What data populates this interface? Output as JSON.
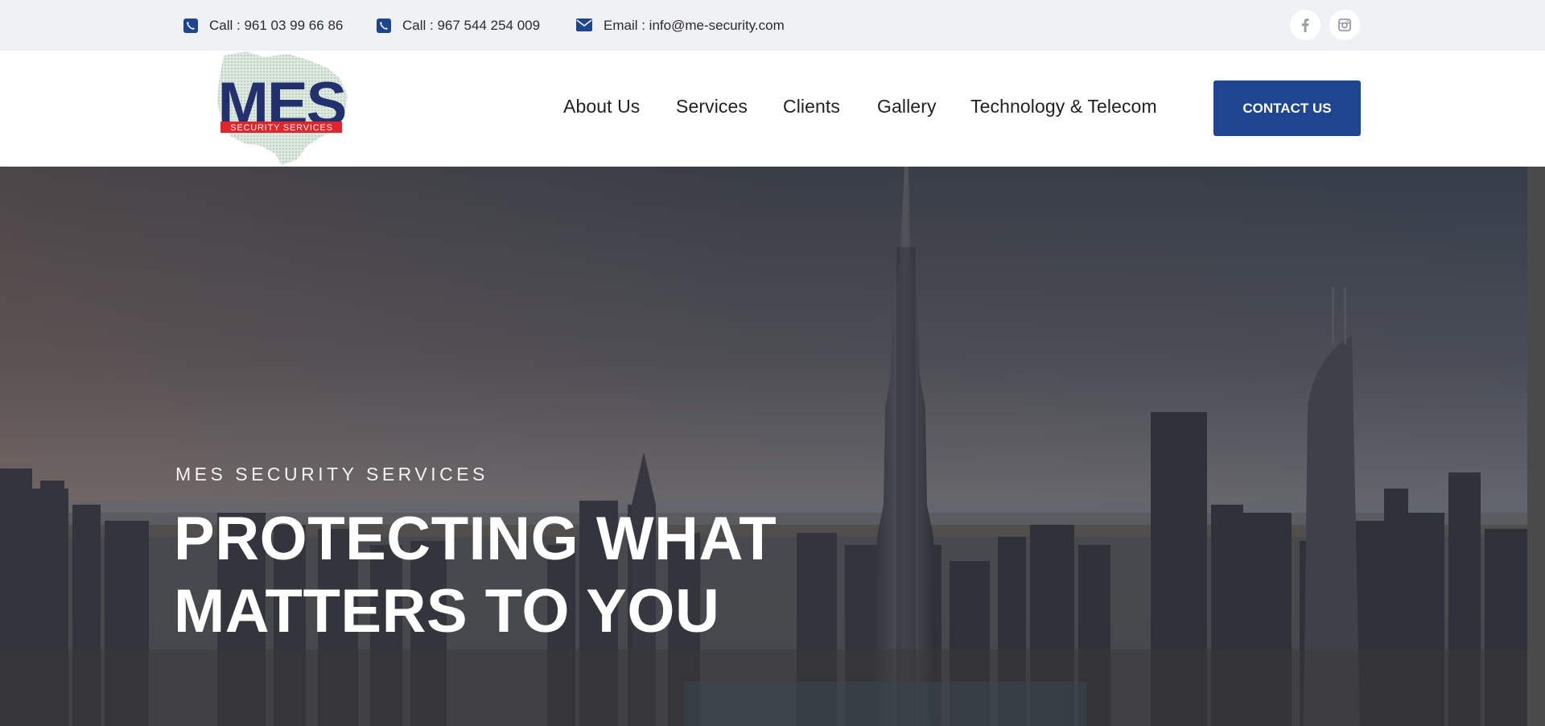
{
  "topbar": {
    "phone1": "Call : 961 03 99 66 86",
    "phone2": "Call : 967 544 254 009",
    "email": "Email : info@me-security.com",
    "phone_icon": "phone-icon",
    "email_icon": "envelope-icon",
    "social": [
      "facebook-icon",
      "instagram-icon"
    ]
  },
  "logo": {
    "mark": "MES",
    "tagline": "SECURITY SERVICES"
  },
  "nav": {
    "items": [
      "About Us",
      "Services",
      "Clients",
      "Gallery",
      "Technology & Telecom"
    ],
    "cta_label": "CONTACT US"
  },
  "hero": {
    "eyebrow": "MES SECURITY SERVICES",
    "headline_line1": "PROTECTING WHAT",
    "headline_line2": "MATTERS TO YOU"
  },
  "colors": {
    "brand_blue": "#1e4590",
    "logo_red": "#e2252b",
    "topbar_bg": "#f0f1f5"
  }
}
